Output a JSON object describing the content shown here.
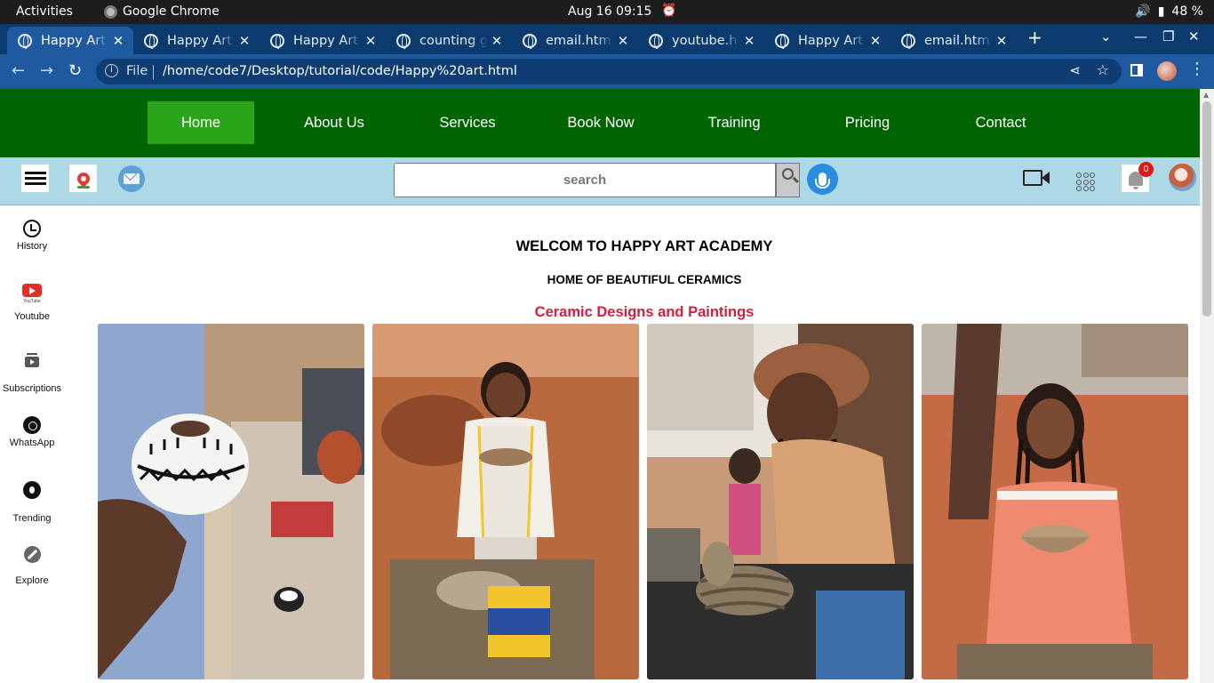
{
  "system_bar": {
    "activities": "Activities",
    "app_name": "Google Chrome",
    "clock": "Aug 16  09:15",
    "battery": "48 %"
  },
  "browser": {
    "tabs": [
      {
        "label": "Happy Art /"
      },
      {
        "label": "Happy Art /"
      },
      {
        "label": "Happy Art /"
      },
      {
        "label": "counting g"
      },
      {
        "label": "email.html"
      },
      {
        "label": "youtube.ht"
      },
      {
        "label": "Happy Art /"
      },
      {
        "label": "email.html"
      }
    ],
    "address": {
      "scheme_label": "File",
      "url": "/home/code7/Desktop/tutorial/code/Happy%20art.html"
    }
  },
  "nav": {
    "items": [
      {
        "label": "Home"
      },
      {
        "label": "About Us"
      },
      {
        "label": "Services"
      },
      {
        "label": "Book Now"
      },
      {
        "label": "Training"
      },
      {
        "label": "Pricing"
      },
      {
        "label": "Contact"
      }
    ],
    "active_color": "#2aa51a",
    "bar_color": "#006400"
  },
  "toolbar": {
    "search_placeholder": "search",
    "notification_count": "0",
    "bar_color": "#add8e6"
  },
  "sidebar": {
    "items": [
      {
        "label": "History",
        "icon": "history-icon"
      },
      {
        "label": "Youtube",
        "icon": "youtube-icon",
        "sub": "YouTube"
      },
      {
        "label": "Subscriptions",
        "icon": "subscriptions-icon"
      },
      {
        "label": "WhatsApp",
        "icon": "whatsapp-icon"
      },
      {
        "label": "Trending",
        "icon": "trending-icon"
      },
      {
        "label": "Explore",
        "icon": "explore-icon"
      }
    ]
  },
  "main": {
    "welcome": "WELCOM TO HAPPY ART ACADEMY",
    "subheading": "HOME OF BEAUTIFUL CERAMICS",
    "section_title": "Ceramic Designs and Paintings",
    "section_title_color": "#d02040",
    "photos": [
      {
        "name": "painted-ceramic-pot-photo"
      },
      {
        "name": "girl-with-clay-bowl-photo"
      },
      {
        "name": "woman-coiling-clay-photo"
      },
      {
        "name": "smiling-girl-with-bowl-photo"
      }
    ]
  }
}
